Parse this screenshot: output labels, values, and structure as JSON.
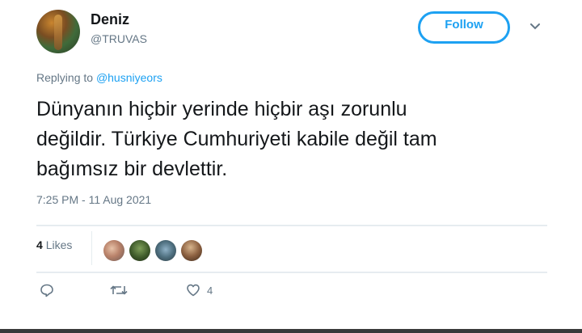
{
  "user": {
    "name": "Deniz",
    "handle": "@TRUVAS"
  },
  "follow_label": "Follow",
  "reply_context": {
    "prefix": "Replying to",
    "mention": "@husniyeors"
  },
  "tweet": {
    "lines": [
      "Dünyanın hiçbir yerinde hiçbir aşı zorunlu",
      "değildir. Türkiye Cumhuriyeti kabile değil tam",
      "bağımsız bir devlettir."
    ],
    "timestamp": "7:25 PM - 11 Aug 2021"
  },
  "likes": {
    "count": "4",
    "label": "Likes"
  },
  "actions": {
    "like_count": "4"
  },
  "colors": {
    "accent": "#1da1f2",
    "muted": "#657786",
    "text": "#14171a"
  }
}
